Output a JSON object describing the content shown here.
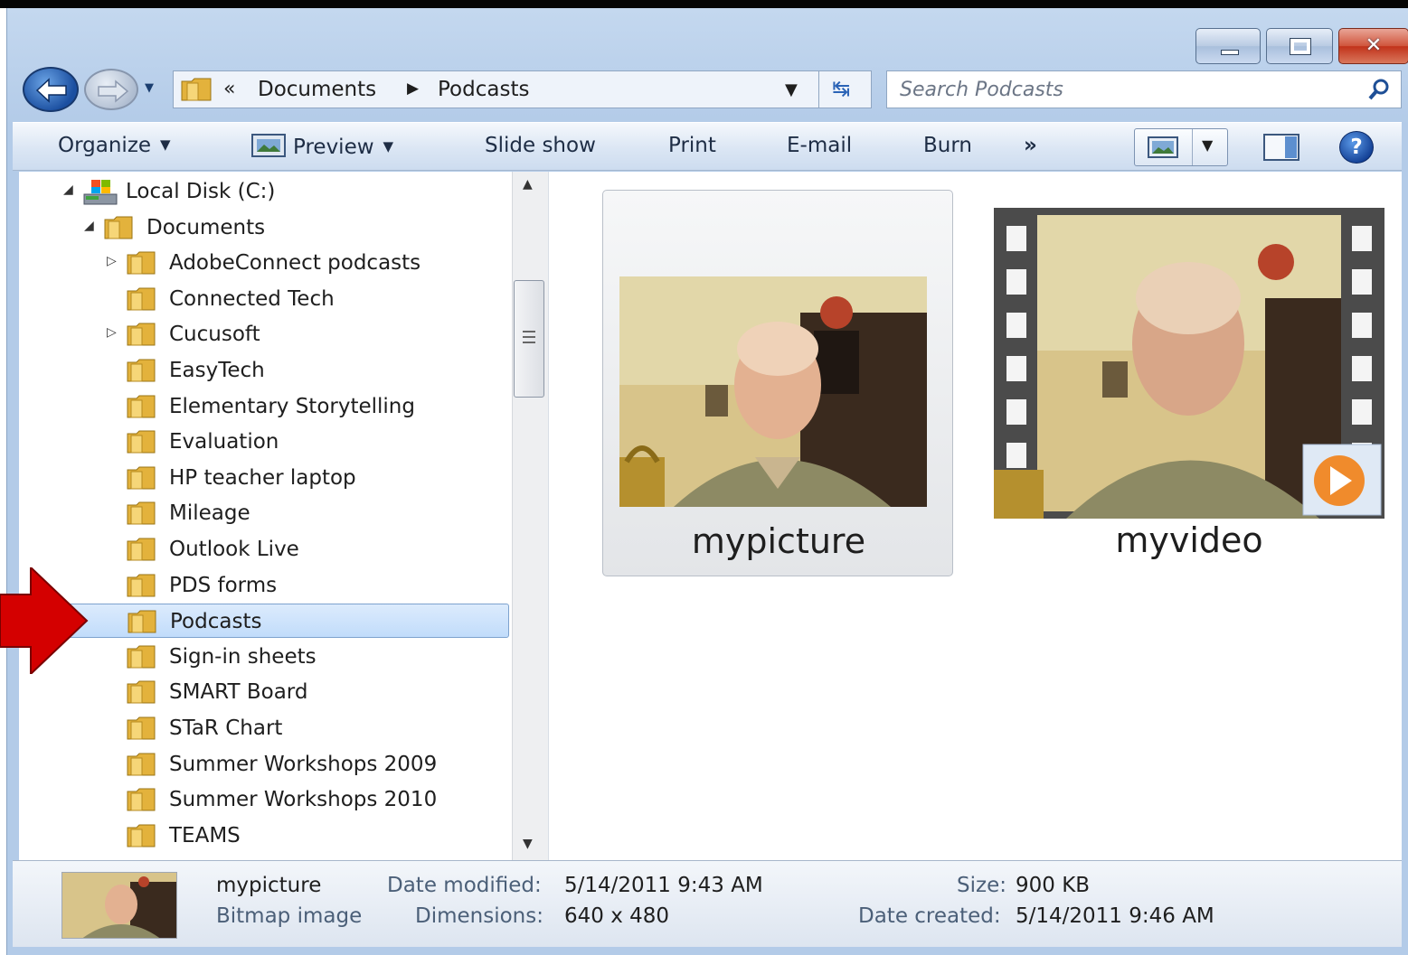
{
  "window": {
    "buttons": {
      "minimize": "minimize",
      "maximize": "maximize",
      "close": "close"
    }
  },
  "address_bar": {
    "overflow_chevron": "«",
    "crumbs": [
      "Documents",
      "Podcasts"
    ]
  },
  "search": {
    "placeholder": "Search Podcasts"
  },
  "toolbar": {
    "organize": "Organize",
    "preview": "Preview",
    "slideshow": "Slide show",
    "print": "Print",
    "email": "E-mail",
    "burn": "Burn",
    "more": "»"
  },
  "nav_tree": [
    {
      "label": "Local Disk (C:)",
      "level": 0,
      "expander": "expanded",
      "icon": "drive-icon"
    },
    {
      "label": "Documents",
      "level": 1,
      "expander": "expanded",
      "icon": "folder-icon"
    },
    {
      "label": "AdobeConnect podcasts",
      "level": 2,
      "expander": "collapsed",
      "icon": "folder-icon"
    },
    {
      "label": "Connected Tech",
      "level": 2,
      "expander": "none",
      "icon": "folder-icon"
    },
    {
      "label": "Cucusoft",
      "level": 2,
      "expander": "collapsed",
      "icon": "folder-icon"
    },
    {
      "label": "EasyTech",
      "level": 2,
      "expander": "none",
      "icon": "folder-icon"
    },
    {
      "label": "Elementary Storytelling",
      "level": 2,
      "expander": "none",
      "icon": "folder-icon"
    },
    {
      "label": "Evaluation",
      "level": 2,
      "expander": "none",
      "icon": "folder-icon"
    },
    {
      "label": "HP teacher laptop",
      "level": 2,
      "expander": "none",
      "icon": "folder-icon"
    },
    {
      "label": "Mileage",
      "level": 2,
      "expander": "none",
      "icon": "folder-icon"
    },
    {
      "label": "Outlook Live",
      "level": 2,
      "expander": "none",
      "icon": "folder-icon"
    },
    {
      "label": "PDS forms",
      "level": 2,
      "expander": "none",
      "icon": "folder-icon"
    },
    {
      "label": "Podcasts",
      "level": 2,
      "expander": "none",
      "icon": "folder-icon",
      "selected": true
    },
    {
      "label": "Sign-in sheets",
      "level": 2,
      "expander": "none",
      "icon": "folder-icon"
    },
    {
      "label": "SMART Board",
      "level": 2,
      "expander": "none",
      "icon": "folder-icon"
    },
    {
      "label": "STaR Chart",
      "level": 2,
      "expander": "none",
      "icon": "folder-icon"
    },
    {
      "label": "Summer Workshops 2009",
      "level": 2,
      "expander": "none",
      "icon": "folder-icon"
    },
    {
      "label": "Summer Workshops 2010",
      "level": 2,
      "expander": "none",
      "icon": "folder-icon"
    },
    {
      "label": "TEAMS",
      "level": 2,
      "expander": "none",
      "icon": "folder-icon"
    }
  ],
  "files": [
    {
      "name": "mypicture",
      "type": "image",
      "selected": true
    },
    {
      "name": "myvideo",
      "type": "video",
      "selected": false
    }
  ],
  "details": {
    "name": "mypicture",
    "type": "Bitmap image",
    "date_modified_label": "Date modified:",
    "date_modified": "5/14/2011 9:43 AM",
    "dimensions_label": "Dimensions:",
    "dimensions": "640 x 480",
    "size_label": "Size:",
    "size": "900 KB",
    "date_created_label": "Date created:",
    "date_created": "5/14/2011 9:46 AM"
  },
  "colors": {
    "selection": "#c1dcfb",
    "window_frame": "#b3cbe8",
    "annotation_arrow": "#d40000"
  }
}
